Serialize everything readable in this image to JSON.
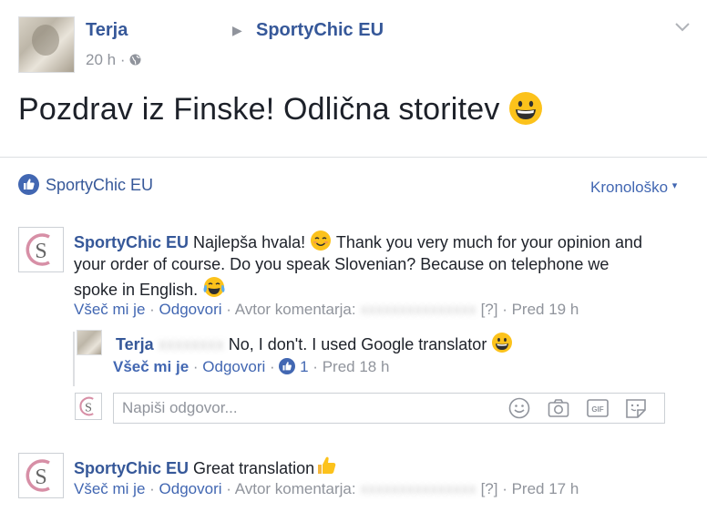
{
  "post": {
    "author": "Terja",
    "page": "SportyChic EU",
    "time": "20 h",
    "separator": "·",
    "text": "Pozdrav iz Finske! Odlična storitev"
  },
  "likes": {
    "name": "SportyChic EU",
    "sort_label": "Kronološko"
  },
  "comments": [
    {
      "author": "SportyChic EU",
      "text_line1": "Najlepša hvala!",
      "text_line1b": "Thank you very much for your opinion and",
      "text_line2": "your order of course. Do you speak Slovenian? Because on telephone we",
      "text_line3": "spoke in English.",
      "like": "Všeč mi je",
      "reply": "Odgovori",
      "author_label": "Avtor komentarja:",
      "hidden_name": "[?]",
      "time": "Pred 19 h"
    },
    {
      "author": "SportyChic EU",
      "text": "Great translation",
      "like": "Všeč mi je",
      "reply": "Odgovori",
      "author_label": "Avtor komentarja:",
      "hidden_name": "[?]",
      "time": "Pred 17 h"
    }
  ],
  "reply": {
    "author": "Terja",
    "text": "No, I don't. I used Google translator",
    "like": "Všeč mi je",
    "reply": "Odgovori",
    "like_count": "1",
    "time": "Pred 18 h"
  },
  "composer": {
    "placeholder": "Napiši odgovor..."
  }
}
